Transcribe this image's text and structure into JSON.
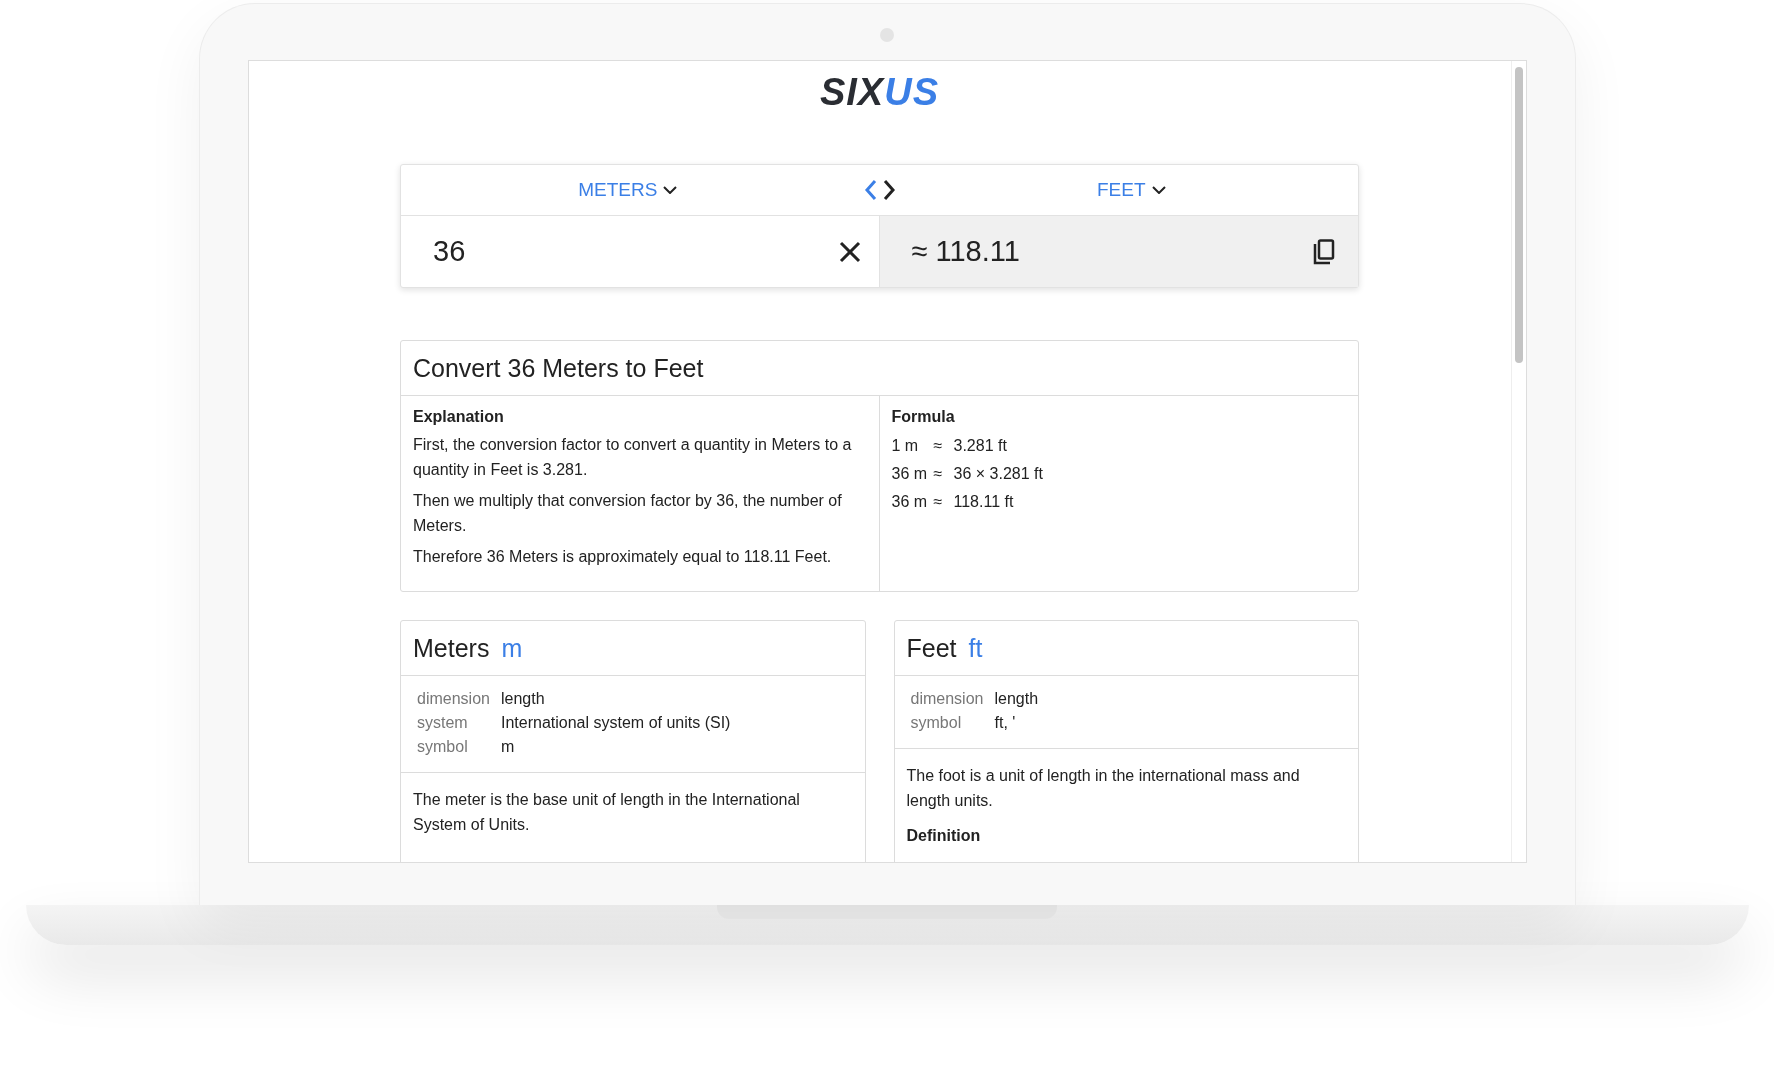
{
  "logo": [
    {
      "text": "SIX",
      "color": "#2a2d33"
    },
    {
      "text": "US",
      "color": "#3b7fe6"
    }
  ],
  "converter": {
    "from_unit": "METERS",
    "to_unit": "FEET",
    "input": "36",
    "result": "≈ 118.11"
  },
  "conversion": {
    "title": "Convert 36 Meters to Feet",
    "explanation": {
      "heading": "Explanation",
      "paragraphs": [
        "First, the conversion factor to convert a quantity in Meters to a quantity in Feet is 3.281.",
        "Then we multiply that conversion factor by 36, the number of Meters.",
        "Therefore 36 Meters is approximately equal to 118.11 Feet."
      ]
    },
    "formula": {
      "heading": "Formula",
      "lines": [
        {
          "left": "1 m",
          "op": "≈",
          "right": "3.281 ft"
        },
        {
          "left": "36 m",
          "op": "≈",
          "right": "36 × 3.281 ft"
        },
        {
          "left": "36 m",
          "op": "≈",
          "right": "118.11 ft"
        }
      ]
    }
  },
  "units": [
    {
      "name": "Meters",
      "symbol": "m",
      "properties": [
        {
          "label": "dimension",
          "value": "length"
        },
        {
          "label": "system",
          "value": "International system of units (SI)"
        },
        {
          "label": "symbol",
          "value": "m"
        }
      ],
      "description": "The meter is the base unit of length in the International System of Units."
    },
    {
      "name": "Feet",
      "symbol": "ft",
      "properties": [
        {
          "label": "dimension",
          "value": "length"
        },
        {
          "label": "symbol",
          "value": "ft, '"
        }
      ],
      "description": "The foot is a unit of length in the international mass and length units.",
      "subheading": "Definition"
    }
  ]
}
